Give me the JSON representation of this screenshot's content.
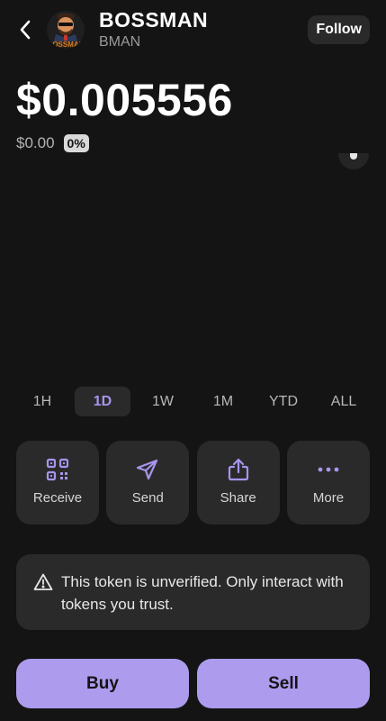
{
  "header": {
    "token_name": "BOSSMAN",
    "token_symbol": "BMAN",
    "avatar_text": "BOSSMAN",
    "follow_label": "Follow"
  },
  "price": {
    "value": "$0.005556",
    "change_value": "$0.00",
    "change_percent": "0%"
  },
  "range_tabs": [
    {
      "label": "1H",
      "active": false
    },
    {
      "label": "1D",
      "active": true
    },
    {
      "label": "1W",
      "active": false
    },
    {
      "label": "1M",
      "active": false
    },
    {
      "label": "YTD",
      "active": false
    },
    {
      "label": "ALL",
      "active": false
    }
  ],
  "actions": [
    {
      "label": "Receive",
      "icon": "qr-code-icon"
    },
    {
      "label": "Send",
      "icon": "send-icon"
    },
    {
      "label": "Share",
      "icon": "share-icon"
    },
    {
      "label": "More",
      "icon": "more-dots-icon"
    }
  ],
  "warning": {
    "icon": "warning-icon",
    "text": "This token is unverified. Only interact with tokens you trust."
  },
  "trade": {
    "buy_label": "Buy",
    "sell_label": "Sell"
  },
  "colors": {
    "background": "#141414",
    "surface": "#2a2a2a",
    "accent": "#ad9bee",
    "accent_text": "#a894ec"
  }
}
